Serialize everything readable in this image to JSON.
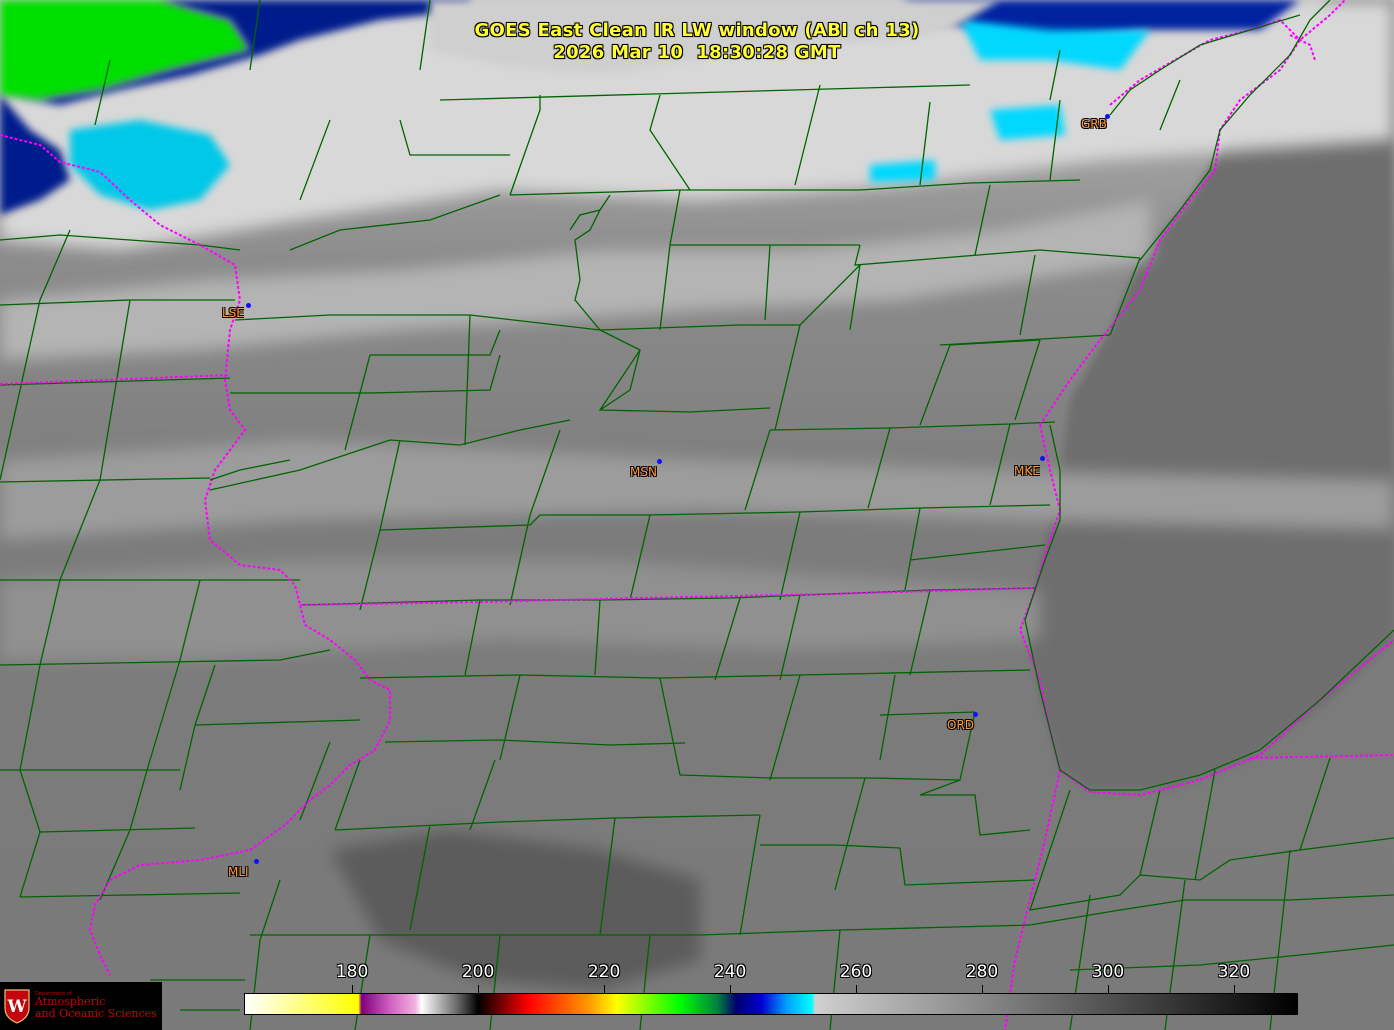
{
  "header": {
    "title_line1": "GOES East Clean IR LW window (ABI ch 13)",
    "title_line2": "2026 Mar 10  18:30:28 GMT",
    "title_color": "#ffff33"
  },
  "stations": [
    {
      "id": "GRB",
      "label": "GRB"
    },
    {
      "id": "LSE",
      "label": "LSE"
    },
    {
      "id": "MSN",
      "label": "MSN"
    },
    {
      "id": "MKE",
      "label": "MKE"
    },
    {
      "id": "ORD",
      "label": "ORD"
    },
    {
      "id": "MLI",
      "label": "MLI"
    }
  ],
  "colorbar": {
    "unit_ticks": [
      "180",
      "200",
      "220",
      "240",
      "260",
      "280",
      "300",
      "320"
    ],
    "range": [
      163,
      330
    ],
    "stops": [
      {
        "t": 163,
        "color": "#ffffff"
      },
      {
        "t": 181,
        "color": "#ffff00"
      },
      {
        "t": 181.5,
        "color": "#7f007f"
      },
      {
        "t": 186,
        "color": "#d060c0"
      },
      {
        "t": 190,
        "color": "#f0b0e0"
      },
      {
        "t": 191,
        "color": "#ffffff"
      },
      {
        "t": 197,
        "color": "#606060"
      },
      {
        "t": 200,
        "color": "#000000"
      },
      {
        "t": 208,
        "color": "#ff0000"
      },
      {
        "t": 218,
        "color": "#ffa000"
      },
      {
        "t": 222,
        "color": "#ffff00"
      },
      {
        "t": 232,
        "color": "#00ff00"
      },
      {
        "t": 238,
        "color": "#008040"
      },
      {
        "t": 241,
        "color": "#000070"
      },
      {
        "t": 245,
        "color": "#0000d0"
      },
      {
        "t": 249,
        "color": "#00a0ff"
      },
      {
        "t": 253,
        "color": "#00ffff"
      },
      {
        "t": 253.5,
        "color": "#d0d0d0"
      },
      {
        "t": 330,
        "color": "#000000"
      }
    ]
  },
  "colors": {
    "county_border": "#006400",
    "state_border": "#ff00ff",
    "station_dot": "#1010ff",
    "station_label": "#ff9a3c"
  },
  "logo": {
    "dept_small": "Department of",
    "line1": "Atmospheric",
    "line2": "and Oceanic Sciences",
    "seal_letter": "W"
  }
}
